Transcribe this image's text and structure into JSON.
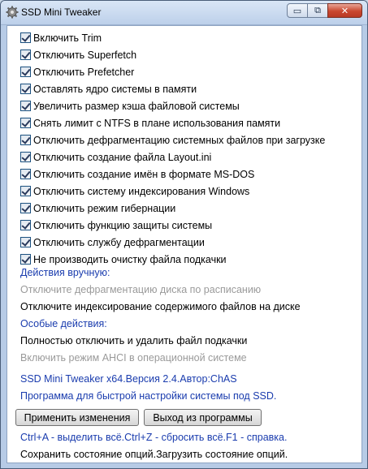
{
  "window": {
    "title": "SSD Mini Tweaker",
    "minimize_glyph": "▭",
    "restore_glyph": "⧉",
    "close_glyph": "✕"
  },
  "options": [
    {
      "label": "Включить Trim",
      "checked": true
    },
    {
      "label": "Отключить Superfetch",
      "checked": true
    },
    {
      "label": "Отключить Prefetcher",
      "checked": true
    },
    {
      "label": "Оставлять ядро системы в памяти",
      "checked": true
    },
    {
      "label": "Увеличить размер кэша файловой системы",
      "checked": true
    },
    {
      "label": "Снять лимит с NTFS в плане использования памяти",
      "checked": true
    },
    {
      "label": "Отключить дефрагментацию системных файлов при загрузке",
      "checked": true
    },
    {
      "label": "Отключить создание файла Layout.ini",
      "checked": true
    },
    {
      "label": "Отключить создание имён в формате MS-DOS",
      "checked": true
    },
    {
      "label": "Отключить систему индексирования Windows",
      "checked": true
    },
    {
      "label": "Отключить режим гибернации",
      "checked": true
    },
    {
      "label": "Отключить функцию защиты системы",
      "checked": true
    },
    {
      "label": "Отключить службу дефрагментации",
      "checked": true
    },
    {
      "label": "Не производить очистку файла подкачки",
      "checked": true
    }
  ],
  "manual": {
    "heading": "Действия вручную:",
    "item1": "Отключите дефрагментацию диска по расписанию",
    "item2": "Отключите индексирование содержимого файлов на диске"
  },
  "special": {
    "heading": "Особые действия:",
    "item1": "Полностью отключить и удалить файл подкачки",
    "item2": "Включить режим AHCI в операционной системе"
  },
  "about": {
    "version": "SSD Mini Tweaker x64.Версия 2.4.Автор:ChAS",
    "description": "Программа для быстрой настройки системы под SSD."
  },
  "buttons": {
    "apply": "Применить изменения",
    "exit": "Выход из программы"
  },
  "hints": {
    "shortcuts": "Ctrl+A - выделить всё.Ctrl+Z - сбросить всё.F1 - справка.",
    "state": "Сохранить состояние опций.Загрузить состояние опций."
  },
  "colors": {
    "link_blue": "#1a3cae",
    "disabled_grey": "#9a9a9a"
  }
}
